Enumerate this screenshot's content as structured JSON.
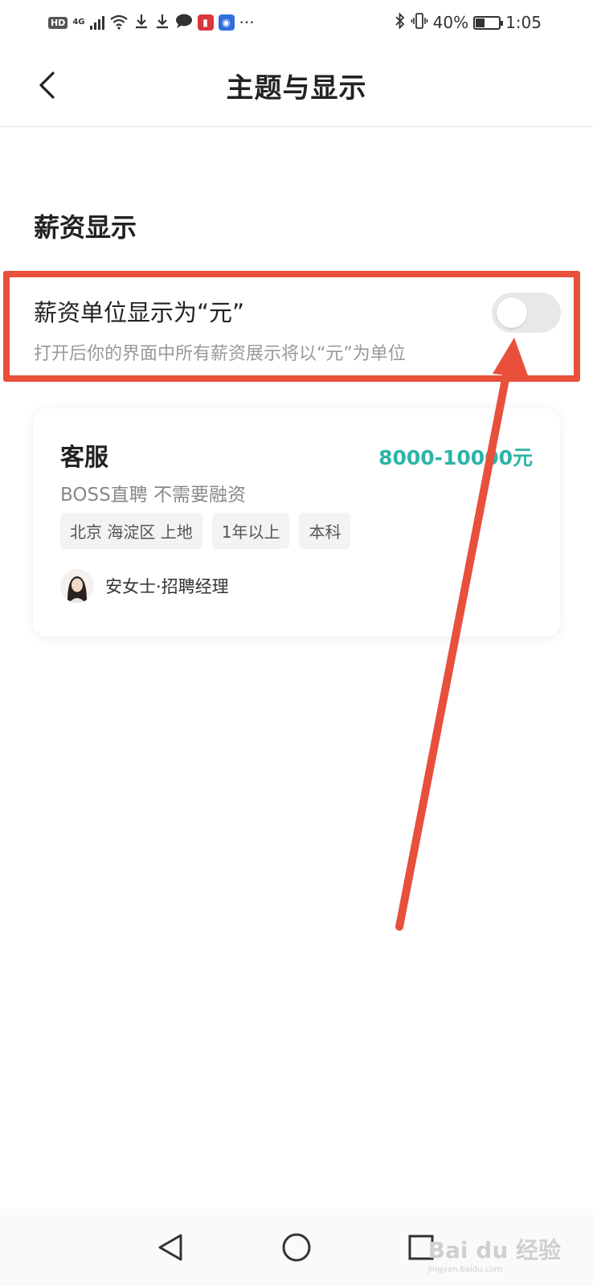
{
  "status_bar": {
    "hd": "HD",
    "network": "4G",
    "more": "···",
    "battery_pct_text": "40%",
    "battery_level": 0.4,
    "time": "1:05"
  },
  "header": {
    "title": "主题与显示"
  },
  "section": {
    "title": "薪资显示"
  },
  "setting": {
    "label": "薪资单位显示为“元”",
    "description": "打开后你的界面中所有薪资展示将以“元”为单位",
    "enabled": false
  },
  "job_card": {
    "title": "客服",
    "salary": "8000-10000元",
    "company": "BOSS直聘 不需要融资",
    "tags": [
      "北京 海淀区 上地",
      "1年以上",
      "本科"
    ],
    "recruiter": "安女士·招聘经理"
  },
  "watermark": {
    "text": "Bai du 经验",
    "sub": "jingyan.baidu.com"
  },
  "colors": {
    "accent": "#2bb5a7",
    "annotation": "#e8503c",
    "toggle_off": "#e8e8e8"
  }
}
